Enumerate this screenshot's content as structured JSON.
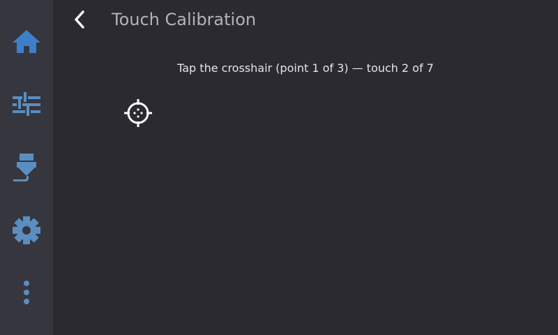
{
  "header": {
    "title": "Touch Calibration",
    "back_icon": "chevron-left-icon"
  },
  "sidebar": {
    "items": [
      {
        "id": "home",
        "icon": "home-icon"
      },
      {
        "id": "tune",
        "icon": "sliders-icon"
      },
      {
        "id": "extrude",
        "icon": "extruder-icon"
      },
      {
        "id": "settings",
        "icon": "gear-icon"
      },
      {
        "id": "more",
        "icon": "more-vertical-icon"
      }
    ]
  },
  "calibration": {
    "instruction": "Tap the crosshair (point 1 of 3) — touch 2 of 7",
    "target_icon": "crosshair-icon"
  },
  "colors": {
    "background": "#2a2a30",
    "sidebar": "#36363e",
    "icon_blue": "#5a8ec2",
    "home_blue": "#3d7fcb",
    "title_text": "#b4b4b8",
    "instruction_text": "#e6e6e8",
    "crosshair": "#ffffff"
  }
}
